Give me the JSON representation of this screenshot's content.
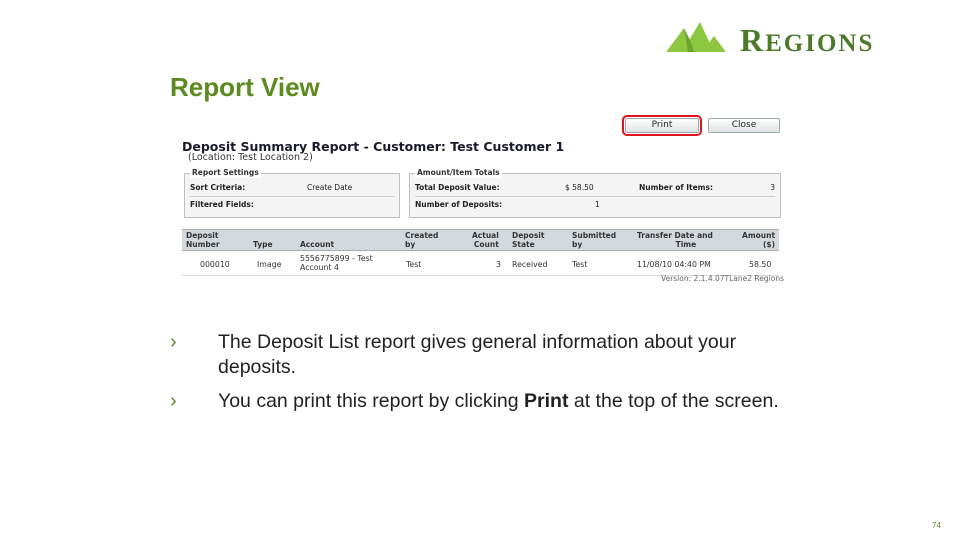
{
  "logo": {
    "text_initial_r": "R",
    "text_egions": "EGIONS",
    "text_rest": ""
  },
  "slide": {
    "title": "Report View"
  },
  "screenshot": {
    "buttons": {
      "print": "Print",
      "close": "Close"
    },
    "report_title": "Deposit Summary Report - Customer: Test Customer 1",
    "report_subtitle": "(Location: Test Location 2)",
    "report_settings": {
      "legend": "Report Settings",
      "sort_label": "Sort Criteria:",
      "sort_value": "Create Date",
      "filter_label": "Filtered Fields:",
      "filter_value": ""
    },
    "totals": {
      "legend": "Amount/Item Totals",
      "total_value_label": "Total Deposit Value:",
      "total_value": "$ 58.50",
      "num_items_label": "Number of Items:",
      "num_items": "3",
      "num_deposits_label": "Number of Deposits:",
      "num_deposits": "1"
    },
    "table": {
      "headers": {
        "deposit_number": [
          "Deposit",
          "Number"
        ],
        "type": "Type",
        "account": "Account",
        "created_by": [
          "Created",
          "by"
        ],
        "actual_count": [
          "Actual",
          "Count"
        ],
        "deposit_state": [
          "Deposit",
          "State"
        ],
        "submitted_by": [
          "Submitted",
          "by"
        ],
        "transfer_date": [
          "Transfer Date and",
          "Time"
        ],
        "amount": [
          "Amount",
          "($)"
        ]
      },
      "rows": [
        {
          "deposit_number": "000010",
          "type": "Image",
          "account_line1": "5556775899 - Test",
          "account_line2": "Account 4",
          "created_by": "Test",
          "actual_count": "3",
          "deposit_state": "Received",
          "submitted_by": "Test",
          "transfer_date": "11/08/10 04:40 PM",
          "amount": "58.50"
        }
      ]
    },
    "version": "Version: 2.1.4.07TLane2 Regions"
  },
  "bullets": [
    {
      "text": "The Deposit List report gives general information about your deposits."
    },
    {
      "text_before": "You can print this report by clicking ",
      "bold": "Print",
      "text_after": " at the top of the screen."
    }
  ],
  "page_number": "74",
  "colors": {
    "brand_green": "#5b8a1f",
    "logo_green": "#8dc63f",
    "highlight_red": "#e0141e"
  }
}
